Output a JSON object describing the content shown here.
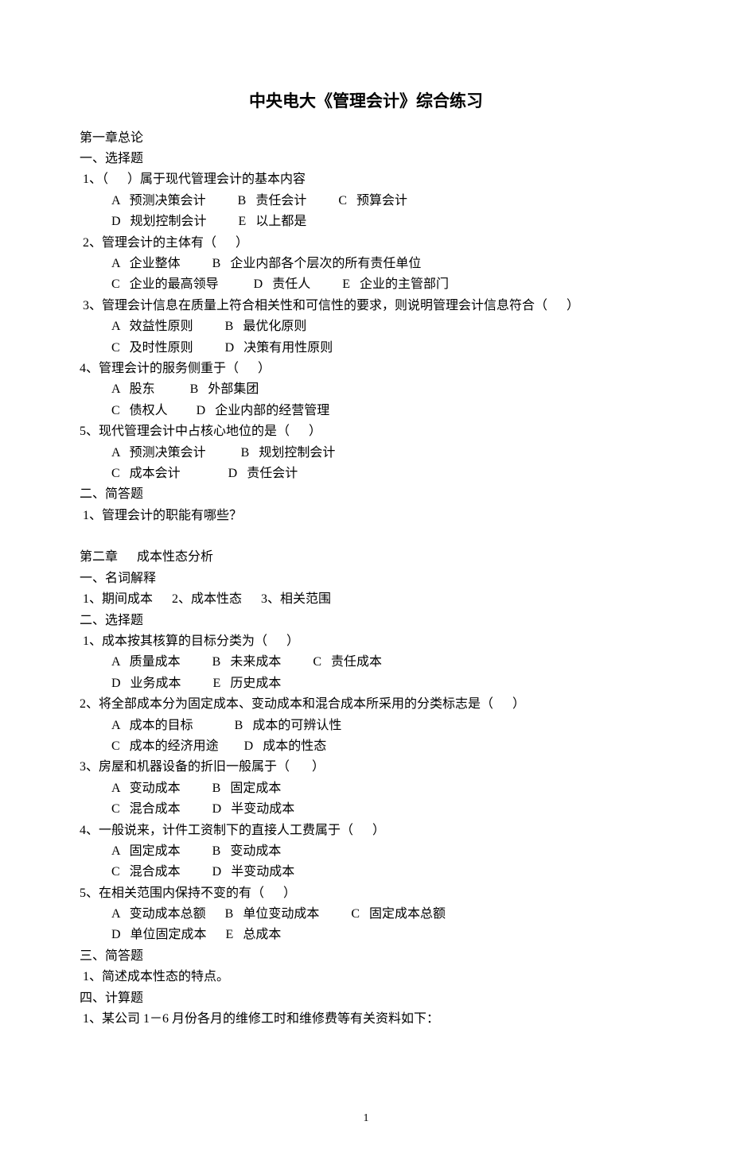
{
  "title": "中央电大《管理会计》综合练习",
  "chapter1": {
    "heading": "第一章总论",
    "section1": {
      "heading": "一、选择题",
      "q1": {
        "stem": " 1、（      ）属于现代管理会计的基本内容",
        "row1": "A   预测决策会计          B   责任会计          C   预算会计",
        "row2": "D   规划控制会计          E   以上都是"
      },
      "q2": {
        "stem": " 2、管理会计的主体有（      ）",
        "row1": "A   企业整体          B   企业内部各个层次的所有责任单位",
        "row2": "C   企业的最高领导           D   责任人          E   企业的主管部门"
      },
      "q3": {
        "stem": " 3、管理会计信息在质量上符合相关性和可信性的要求，则说明管理会计信息符合（      ）",
        "row1": "A   效益性原则          B   最优化原则",
        "row2": "C   及时性原则          D   决策有用性原则"
      },
      "q4": {
        "stem": "4、管理会计的服务侧重于（      ）",
        "row1": "A   股东           B   外部集团",
        "row2": "C   债权人         D   企业内部的经营管理"
      },
      "q5": {
        "stem": "5、现代管理会计中占核心地位的是（      ）",
        "row1": "A   预测决策会计           B   规划控制会计",
        "row2": "C   成本会计               D   责任会计"
      }
    },
    "section2": {
      "heading": "二、简答题",
      "q1": " 1、管理会计的职能有哪些？"
    }
  },
  "chapter2": {
    "heading": "第二章      成本性态分析",
    "section1": {
      "heading": "一、名词解释",
      "line": " 1、期间成本      2、成本性态      3、相关范围"
    },
    "section2": {
      "heading": "二、选择题",
      "q1": {
        "stem": " 1、成本按其核算的目标分类为（      ）",
        "row1": "A   质量成本          B   未来成本          C   责任成本",
        "row2": "D   业务成本          E   历史成本"
      },
      "q2": {
        "stem": "2、将全部成本分为固定成本、变动成本和混合成本所采用的分类标志是（      ）",
        "row1": "A   成本的目标             B   成本的可辨认性",
        "row2": "C   成本的经济用途        D   成本的性态"
      },
      "q3": {
        "stem": "3、房屋和机器设备的折旧一般属于（       ）",
        "row1": "A   变动成本          B   固定成本",
        "row2": "C   混合成本          D   半变动成本"
      },
      "q4": {
        "stem": "4、一般说来，计件工资制下的直接人工费属于（      ）",
        "row1": "A   固定成本          B   变动成本",
        "row2": "C   混合成本          D   半变动成本"
      },
      "q5": {
        "stem": "5、在相关范围内保持不变的有（      ）",
        "row1": "A   变动成本总额      B   单位变动成本          C   固定成本总额",
        "row2": "D   单位固定成本      E   总成本"
      }
    },
    "section3": {
      "heading": "三、简答题",
      "q1": " 1、简述成本性态的特点。"
    },
    "section4": {
      "heading": "四、计算题",
      "q1": " 1、某公司 1－6 月份各月的维修工时和维修费等有关资料如下："
    }
  },
  "pageNumber": "1"
}
